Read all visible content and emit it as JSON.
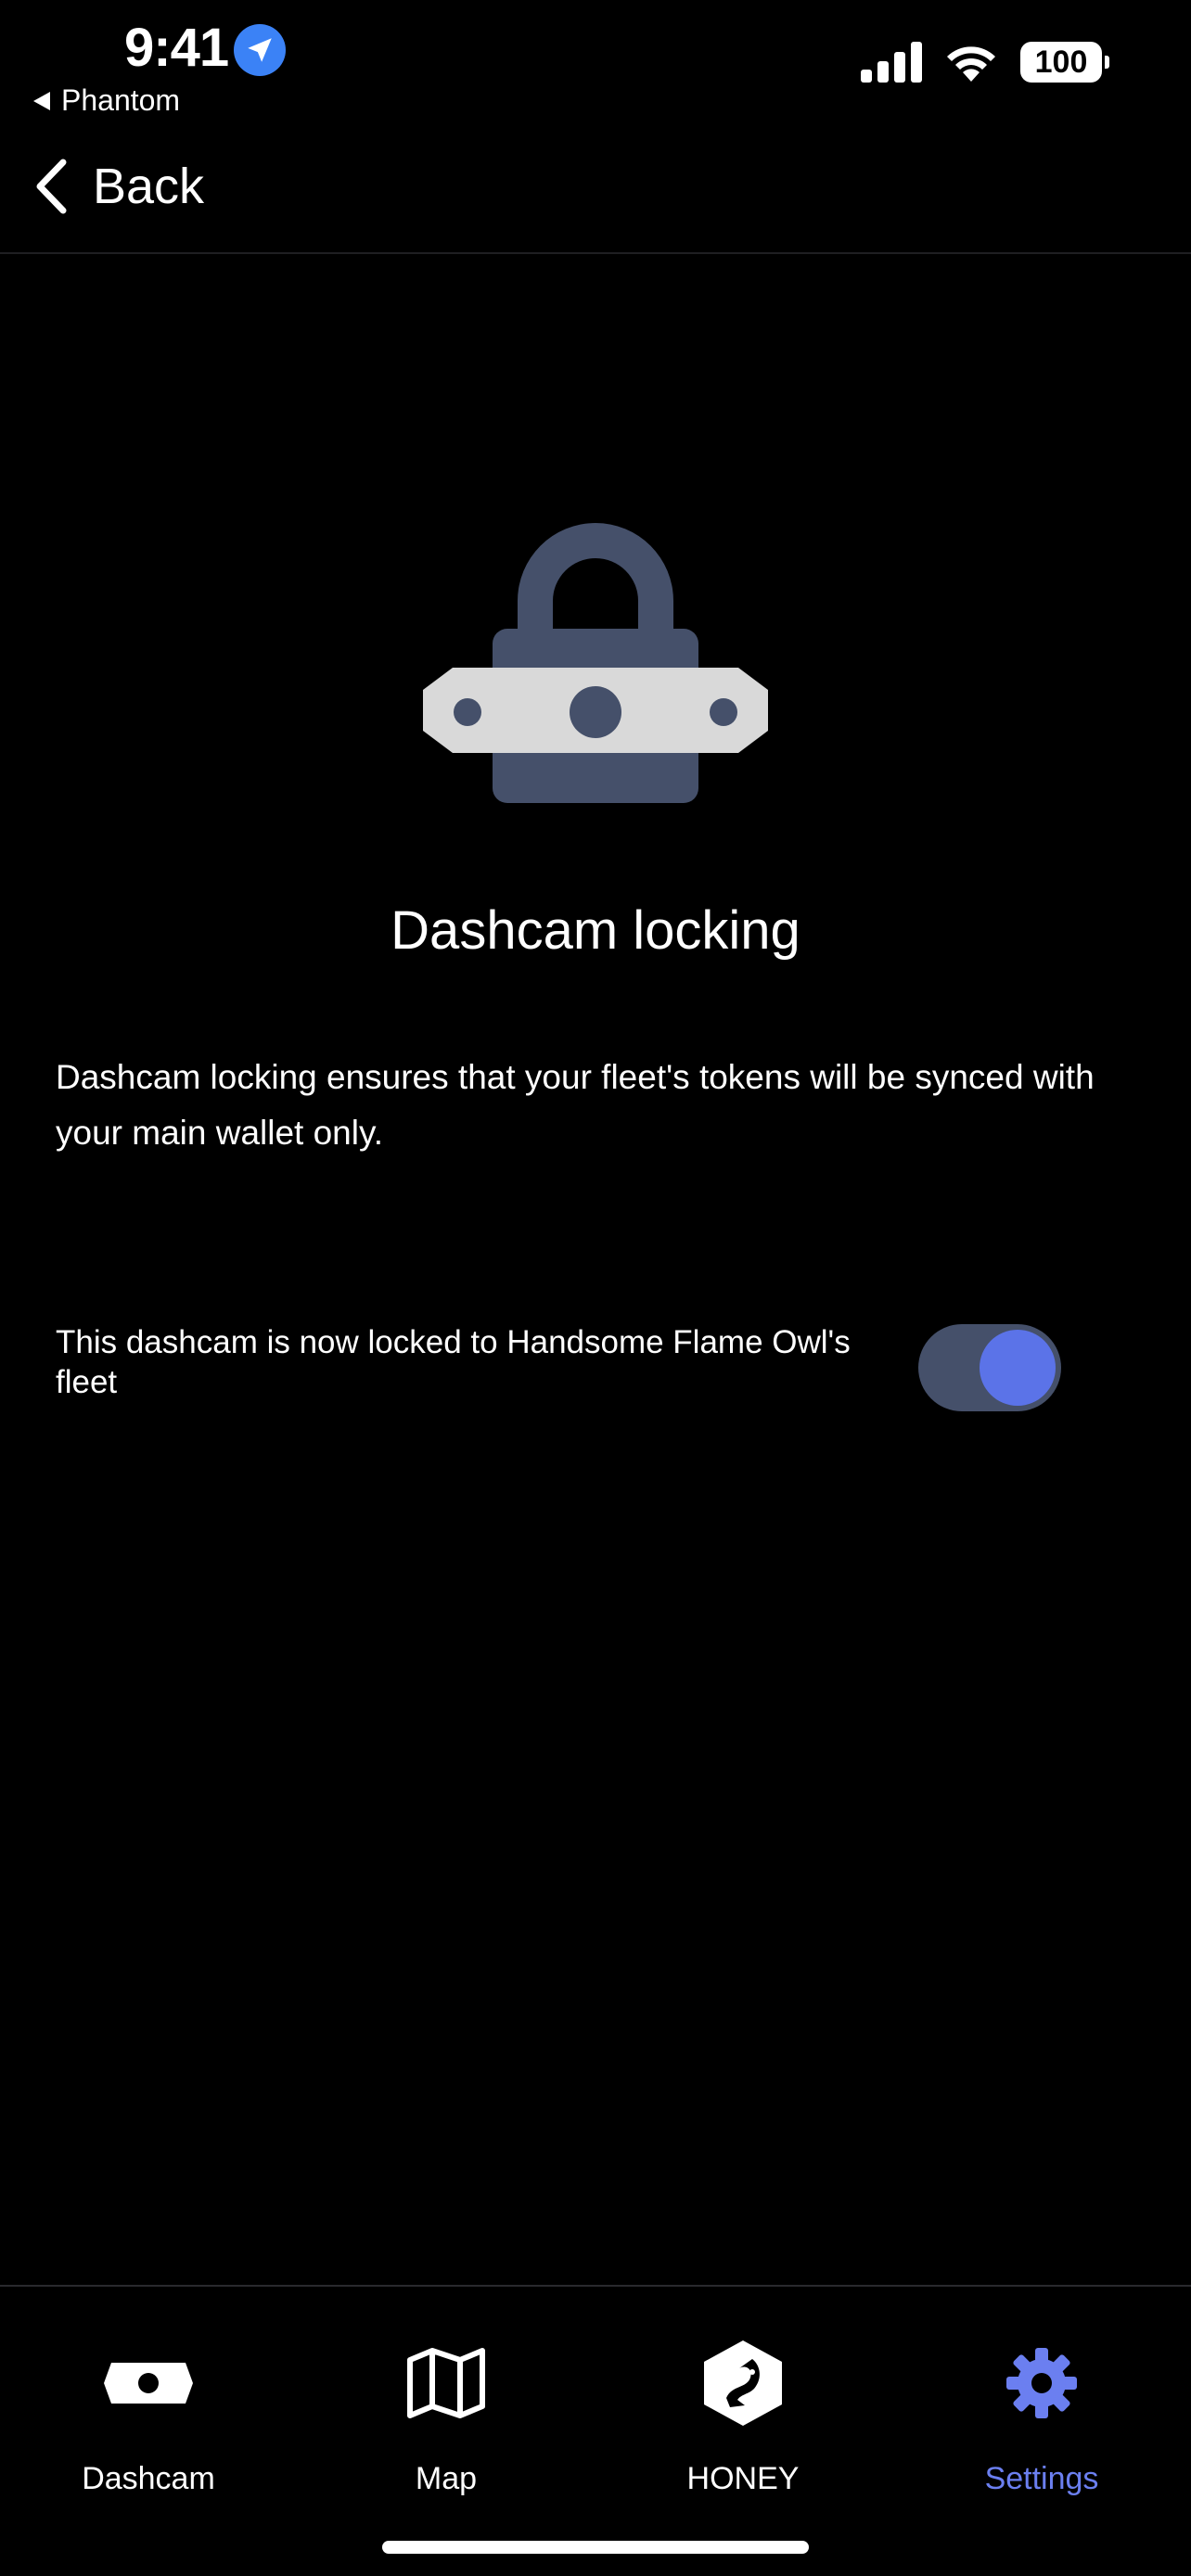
{
  "status_bar": {
    "time": "9:41",
    "back_app": "Phantom",
    "battery": "100"
  },
  "nav": {
    "back_label": "Back"
  },
  "main": {
    "title": "Dashcam locking",
    "description": "Dashcam locking ensures that your fleet's tokens will be synced with your main wallet only.",
    "lock_status": "This dashcam is now locked to Handsome Flame Owl's fleet",
    "toggle_on": true
  },
  "tabs": [
    {
      "label": "Dashcam",
      "icon": "dashcam-icon"
    },
    {
      "label": "Map",
      "icon": "map-icon"
    },
    {
      "label": "HONEY",
      "icon": "honey-icon"
    },
    {
      "label": "Settings",
      "icon": "gear-icon",
      "active": true
    }
  ],
  "colors": {
    "background": "#000000",
    "accent": "#6b7ff0",
    "toggle_track": "#45506a",
    "toggle_knob": "#5b73e8",
    "lock_body": "#45506a",
    "lock_band": "#d9d9d9"
  }
}
